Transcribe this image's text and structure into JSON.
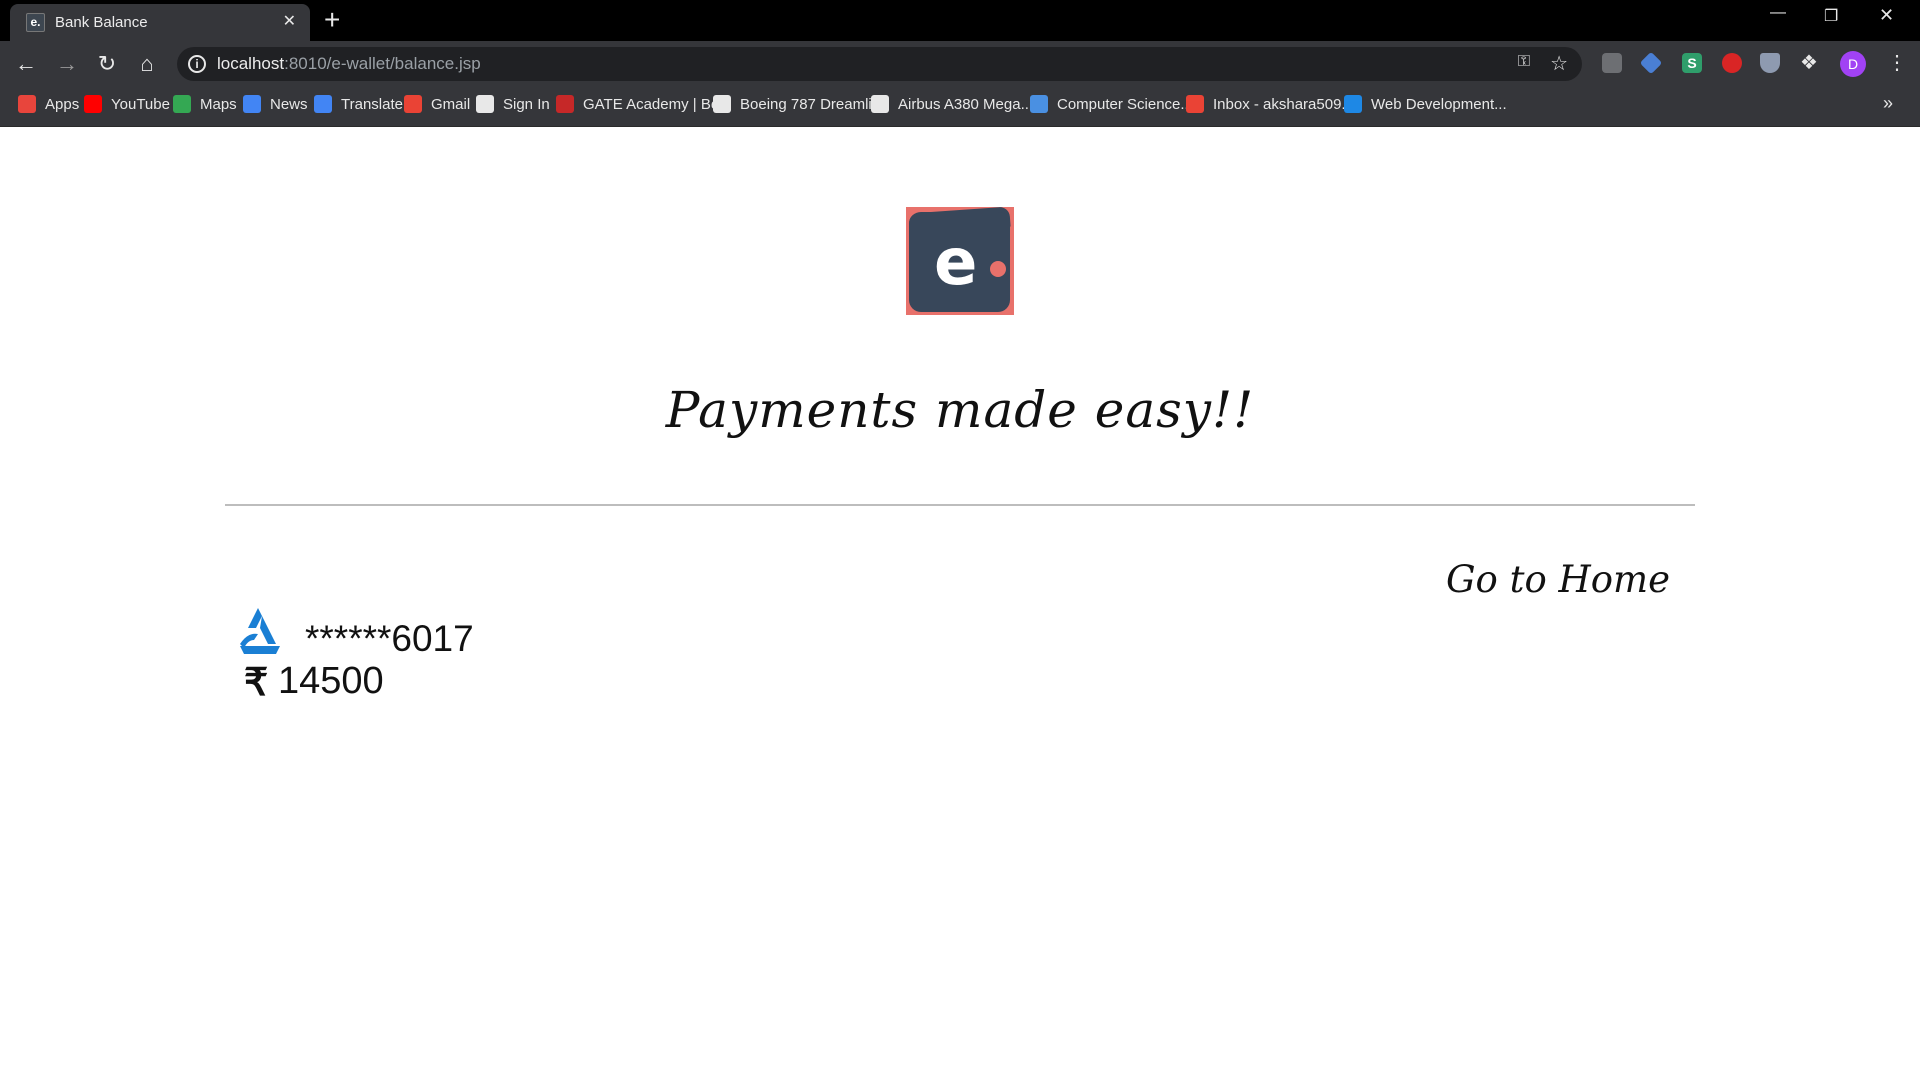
{
  "browser": {
    "tab_title": "Bank Balance",
    "tab_favicon": "e.",
    "close_glyph": "✕",
    "new_tab_glyph": "+",
    "url_host": "localhost",
    "url_rest": ":8010/e-wallet/balance.jsp",
    "profile_initial": "D",
    "ext3_letter": "S"
  },
  "bookmarks": [
    {
      "label": "Apps",
      "icon": "apps-grid-icon",
      "color": "#e8453c"
    },
    {
      "label": "YouTube",
      "icon": "youtube-icon",
      "color": "#ff0000"
    },
    {
      "label": "Maps",
      "icon": "maps-icon",
      "color": "#34a853"
    },
    {
      "label": "News",
      "icon": "news-icon",
      "color": "#4285f4"
    },
    {
      "label": "Translate",
      "icon": "translate-icon",
      "color": "#4285f4"
    },
    {
      "label": "Gmail",
      "icon": "gmail-icon",
      "color": "#ea4335"
    },
    {
      "label": "Sign In",
      "icon": "globe-icon",
      "color": "#e8e8e8"
    },
    {
      "label": "GATE Academy | Be...",
      "icon": "gate-academy-icon",
      "color": "#c62828"
    },
    {
      "label": "Boeing 787 Dreamli...",
      "icon": "flightaware-icon",
      "color": "#e8e8e8"
    },
    {
      "label": "Airbus A380 Mega...",
      "icon": "flightaware-icon",
      "color": "#e8e8e8"
    },
    {
      "label": "Computer Science...",
      "icon": "infinity-icon",
      "color": "#4a90e2"
    },
    {
      "label": "Inbox - akshara509...",
      "icon": "gmail-icon",
      "color": "#ea4335"
    },
    {
      "label": "Web Development...",
      "icon": "is-icon",
      "color": "#1e88e5"
    }
  ],
  "page": {
    "logo_letter": "e",
    "tagline": "Payments made easy!!",
    "home_link": "Go to Home",
    "account_masked": "******6017",
    "currency_symbol": "₹",
    "balance": "14500"
  },
  "colors": {
    "logo_bg": "#e8716b",
    "wallet": "#38475a",
    "bank_logo": "#1a7fd4"
  }
}
